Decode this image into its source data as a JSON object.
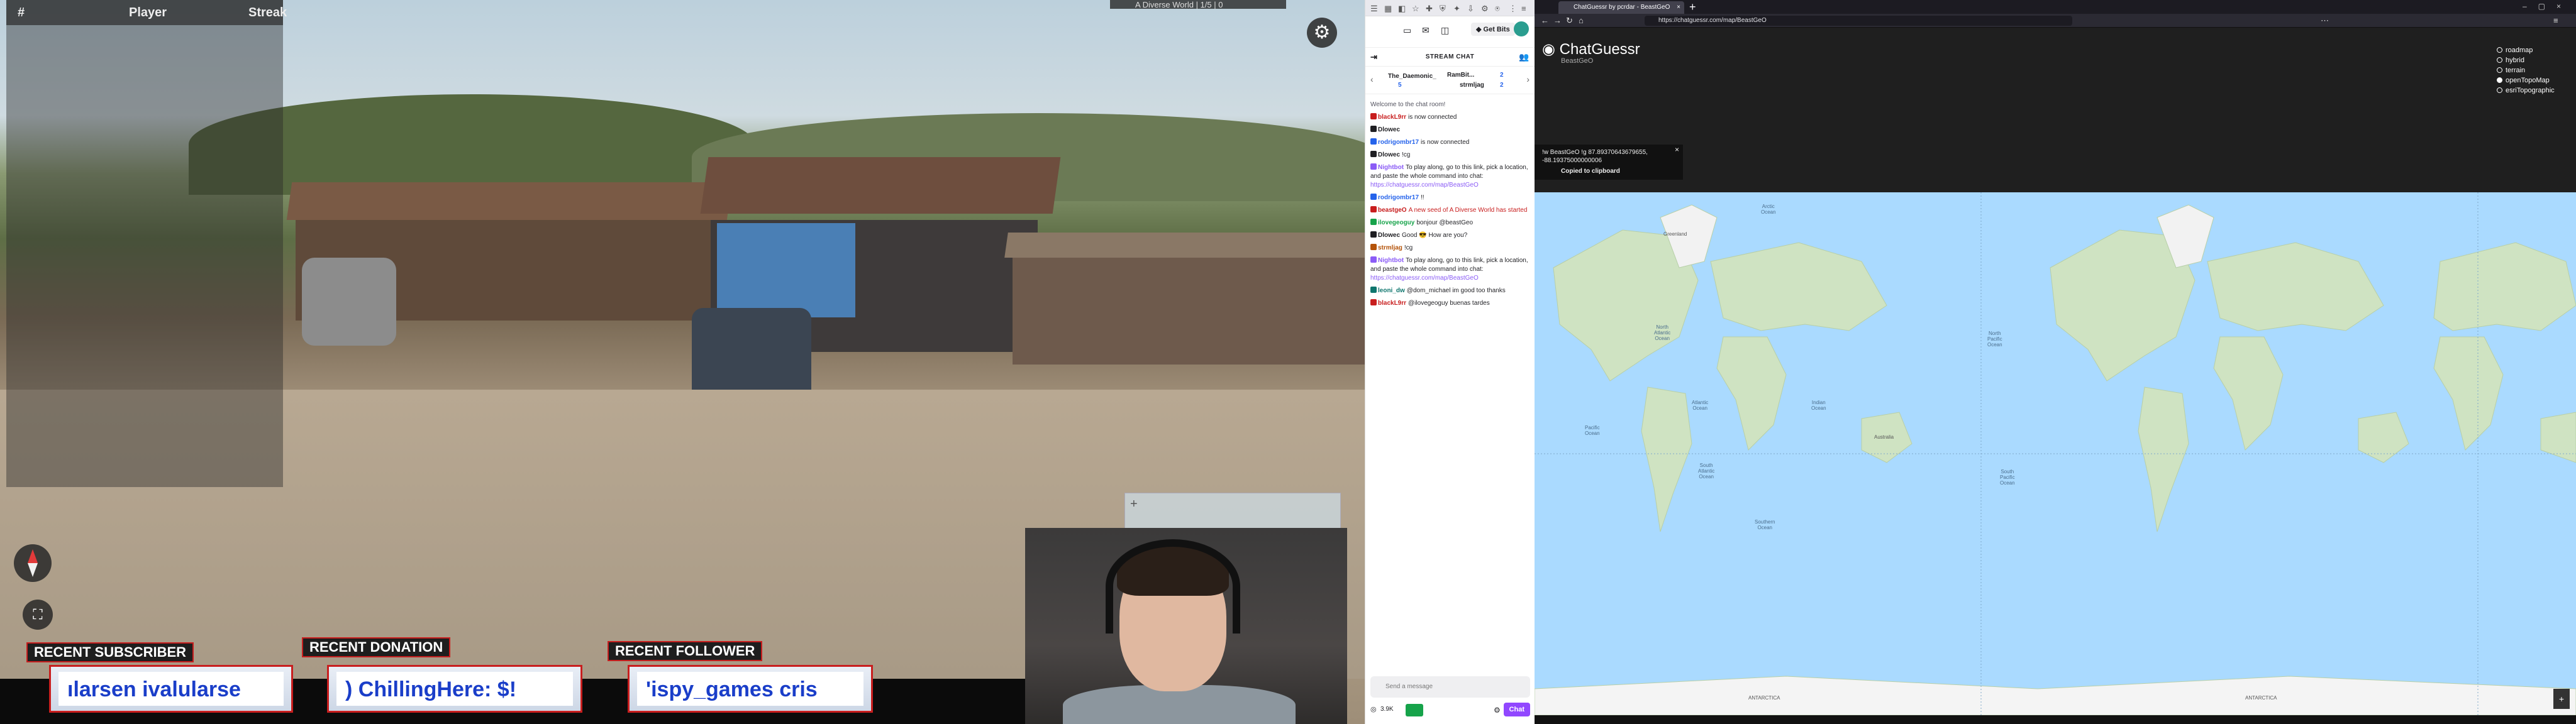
{
  "stream": {
    "top_bar": {
      "hash": "#",
      "player": "Player",
      "streak": "Streak"
    },
    "seed_tag": "A Diverse World | 1/5 | 0",
    "settings_icon": "gear-icon",
    "compass_icon": "compass-icon",
    "fullscreen_icon": "fullscreen-icon",
    "minimap_zoom": "+",
    "tickers": [
      {
        "label": "RECENT SUBSCRIBER",
        "text": "ılarsen    ivalularse"
      },
      {
        "label": "RECENT DONATION",
        "text": ")   ChillingHere: $!"
      },
      {
        "label": "RECENT FOLLOWER",
        "text": "'ispy_games    cris"
      }
    ]
  },
  "chat": {
    "get_bits": "Get Bits",
    "header": "STREAM CHAT",
    "leaderboard": [
      {
        "name": "The_Daemonic_",
        "count": "5"
      },
      {
        "name": "RamBit...",
        "count": "2"
      },
      {
        "name": "strmljag",
        "count": "2"
      }
    ],
    "messages": [
      {
        "user": "",
        "text": "Welcome to the chat room!",
        "color": "#53535f"
      },
      {
        "user": "blackL9rr",
        "text": "is now connected",
        "color": "#c81e1e"
      },
      {
        "user": "Dlowec",
        "text": "",
        "color": "#1f1f23"
      },
      {
        "user": "rodrigombr17",
        "text": "is now connected",
        "color": "#2563eb"
      },
      {
        "user": "Dlowec",
        "text": "!cg",
        "color": "#1f1f23"
      },
      {
        "user": "Nightbot",
        "text": "To play along, go to this link, pick a location, and paste the whole command into chat:",
        "link": "https://chatguessr.com/map/BeastGeO",
        "color": "#8b5cf6"
      },
      {
        "user": "rodrigombr17",
        "text": "!!",
        "color": "#2563eb"
      },
      {
        "user": "beastgeO",
        "text": "A new seed of A Diverse World has started",
        "color": "#c81e1e",
        "text_color": "#c81e1e"
      },
      {
        "user": "ilovegeoguy",
        "text": "bonjour @beastGeo",
        "color": "#16a34a"
      },
      {
        "user": "Dlowec",
        "text": "Good 😎 How are you?",
        "color": "#1f1f23"
      },
      {
        "user": "strmljag",
        "text": "!cg",
        "color": "#b45309"
      },
      {
        "user": "Nightbot",
        "text": "To play along, go to this link, pick a location, and paste the whole command into chat:",
        "link": "https://chatguessr.com/map/BeastGeO",
        "color": "#8b5cf6"
      },
      {
        "user": "leoni_dw",
        "text": "@dom_michael im good too thanks",
        "color": "#0f766e"
      },
      {
        "user": "blackL9rr",
        "text": "@ilovegeoguy buenas tardes",
        "color": "#c81e1e"
      }
    ],
    "input_placeholder": "Send a message",
    "points": "3.9K",
    "chat_button": "Chat"
  },
  "browser": {
    "tab_title": "ChatGuessr by pcrdar - BeastGeO",
    "url": "https://chatguessr.com/map/BeastGeO",
    "site_logo": "ChatGuessr",
    "site_sub": "BeastGeO",
    "layers": [
      "roadmap",
      "hybrid",
      "terrain",
      "openTopoMap",
      "esriTopographic"
    ],
    "selected_layer": "openTopoMap",
    "popup": {
      "command": "!w BeastGeO !g 87.89370643679655, -88.19375000000006",
      "status": "Copied to clipboard"
    },
    "map_labels": {
      "pacific": "Pacific\nOcean",
      "atlantic": "Atlantic\nOcean",
      "indian": "Indian\nOcean",
      "antarctica": "ANTARCTICA",
      "greenland": "Greenland",
      "australia": "Australia",
      "southern": "Southern\nOcean",
      "arctic": "Arctic\nOcean",
      "north_atlantic": "North\nAtlantic\nOcean",
      "south_atlantic": "South\nAtlantic\nOcean",
      "north_pacific": "North\nPacific\nOcean",
      "south_pacific": "South\nPacific\nOcean"
    }
  }
}
